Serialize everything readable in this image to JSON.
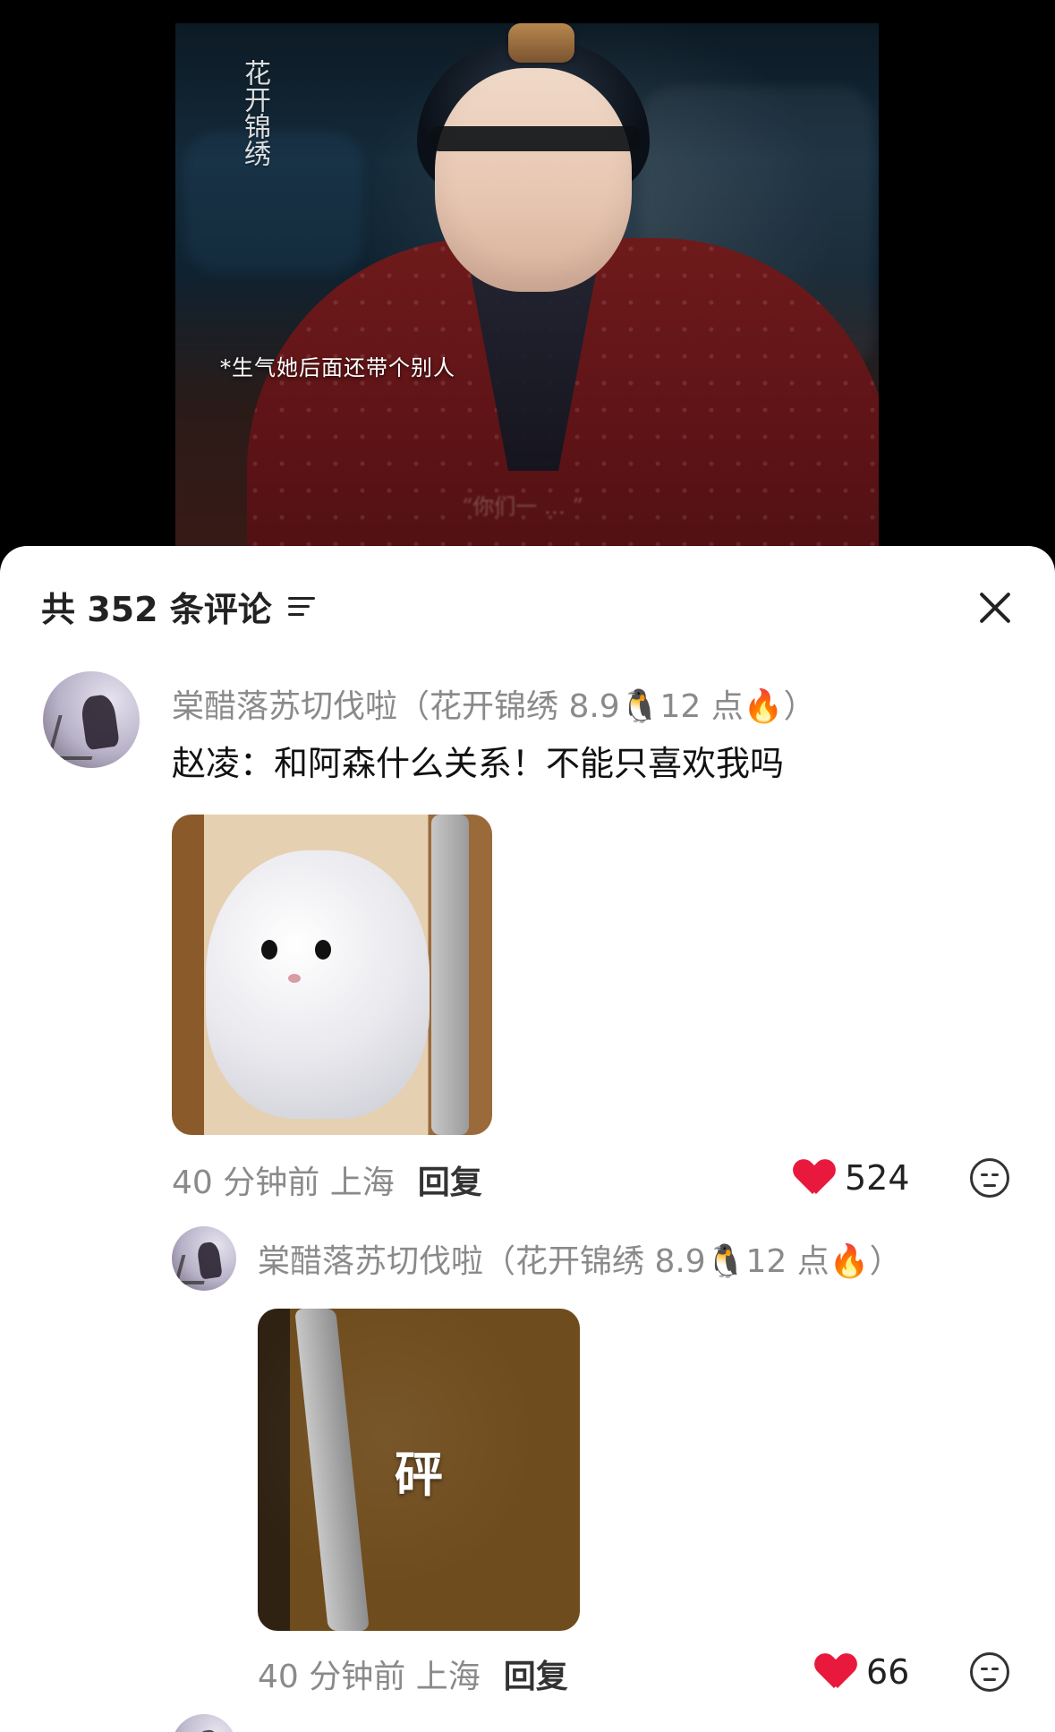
{
  "video": {
    "logo_text": "花开锦绣",
    "subtitle": "*生气她后面还带个别人",
    "faint_subtitle": "“你们一 … ”"
  },
  "comments_panel": {
    "title": "共 352 条评论",
    "filter_icon": "filter-lines-icon",
    "close_icon": "close-icon"
  },
  "comments": [
    {
      "username": "棠醋落苏切伐啦（花开锦绣 8.9",
      "username_suffix_emoji": "🐧",
      "username_tail": "12 点",
      "username_tail_emoji": "🔥",
      "username_close": "）",
      "text": "赵凌：和阿森什么关系！不能只喜欢我吗",
      "time_location": "40 分钟前 上海",
      "reply_label": "回复",
      "likes": "524",
      "sticker": "cat-behind-door"
    },
    {
      "username": "棠醋落苏切伐啦（花开锦绣 8.9",
      "username_suffix_emoji": "🐧",
      "username_tail": "12 点",
      "username_tail_emoji": "🔥",
      "username_close": "）",
      "sticker_text": "砰",
      "time_location": "40 分钟前 上海",
      "reply_label": "回复",
      "likes": "66",
      "sticker": "door-closing"
    }
  ],
  "colors": {
    "heart": "#e8193c",
    "secondary_text": "#8a8a8a",
    "primary_text": "#111111"
  }
}
